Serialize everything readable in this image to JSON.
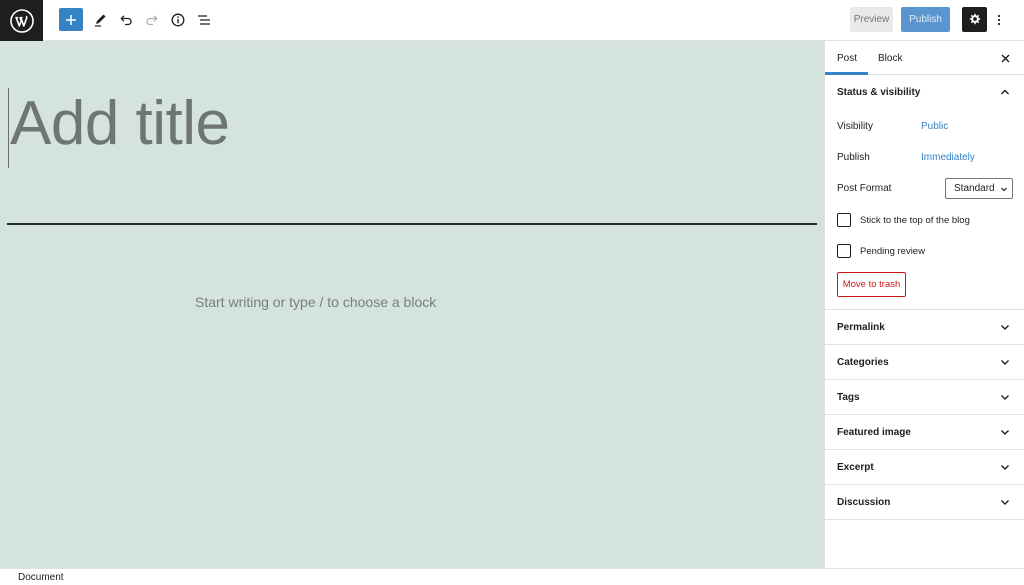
{
  "toolbar": {
    "preview_label": "Preview",
    "publish_label": "Publish"
  },
  "editor": {
    "title_placeholder": "Add title",
    "block_placeholder": "Start writing or type / to choose a block"
  },
  "sidebar": {
    "tabs": [
      {
        "label": "Post",
        "active": true
      },
      {
        "label": "Block",
        "active": false
      }
    ],
    "status_visibility": {
      "title": "Status & visibility",
      "visibility_label": "Visibility",
      "visibility_value": "Public",
      "publish_label": "Publish",
      "publish_value": "Immediately",
      "post_format_label": "Post Format",
      "post_format_value": "Standard",
      "stick_label": "Stick to the top of the blog",
      "pending_label": "Pending review",
      "trash_label": "Move to trash"
    },
    "panels": [
      {
        "title": "Permalink"
      },
      {
        "title": "Categories"
      },
      {
        "title": "Tags"
      },
      {
        "title": "Featured image"
      },
      {
        "title": "Excerpt"
      },
      {
        "title": "Discussion"
      }
    ]
  },
  "footer": {
    "breadcrumb": "Document"
  },
  "colors": {
    "accent": "#3582c4",
    "canvas_bg": "#d5e3dd",
    "danger": "#cc1818",
    "dark": "#1e1e1e"
  },
  "icons": [
    "wordpress-logo-icon",
    "plus-icon",
    "pencil-icon",
    "undo-icon",
    "redo-icon",
    "info-icon",
    "list-view-icon",
    "gear-icon",
    "more-vertical-icon",
    "close-icon",
    "chevron-up-icon",
    "chevron-down-icon"
  ]
}
